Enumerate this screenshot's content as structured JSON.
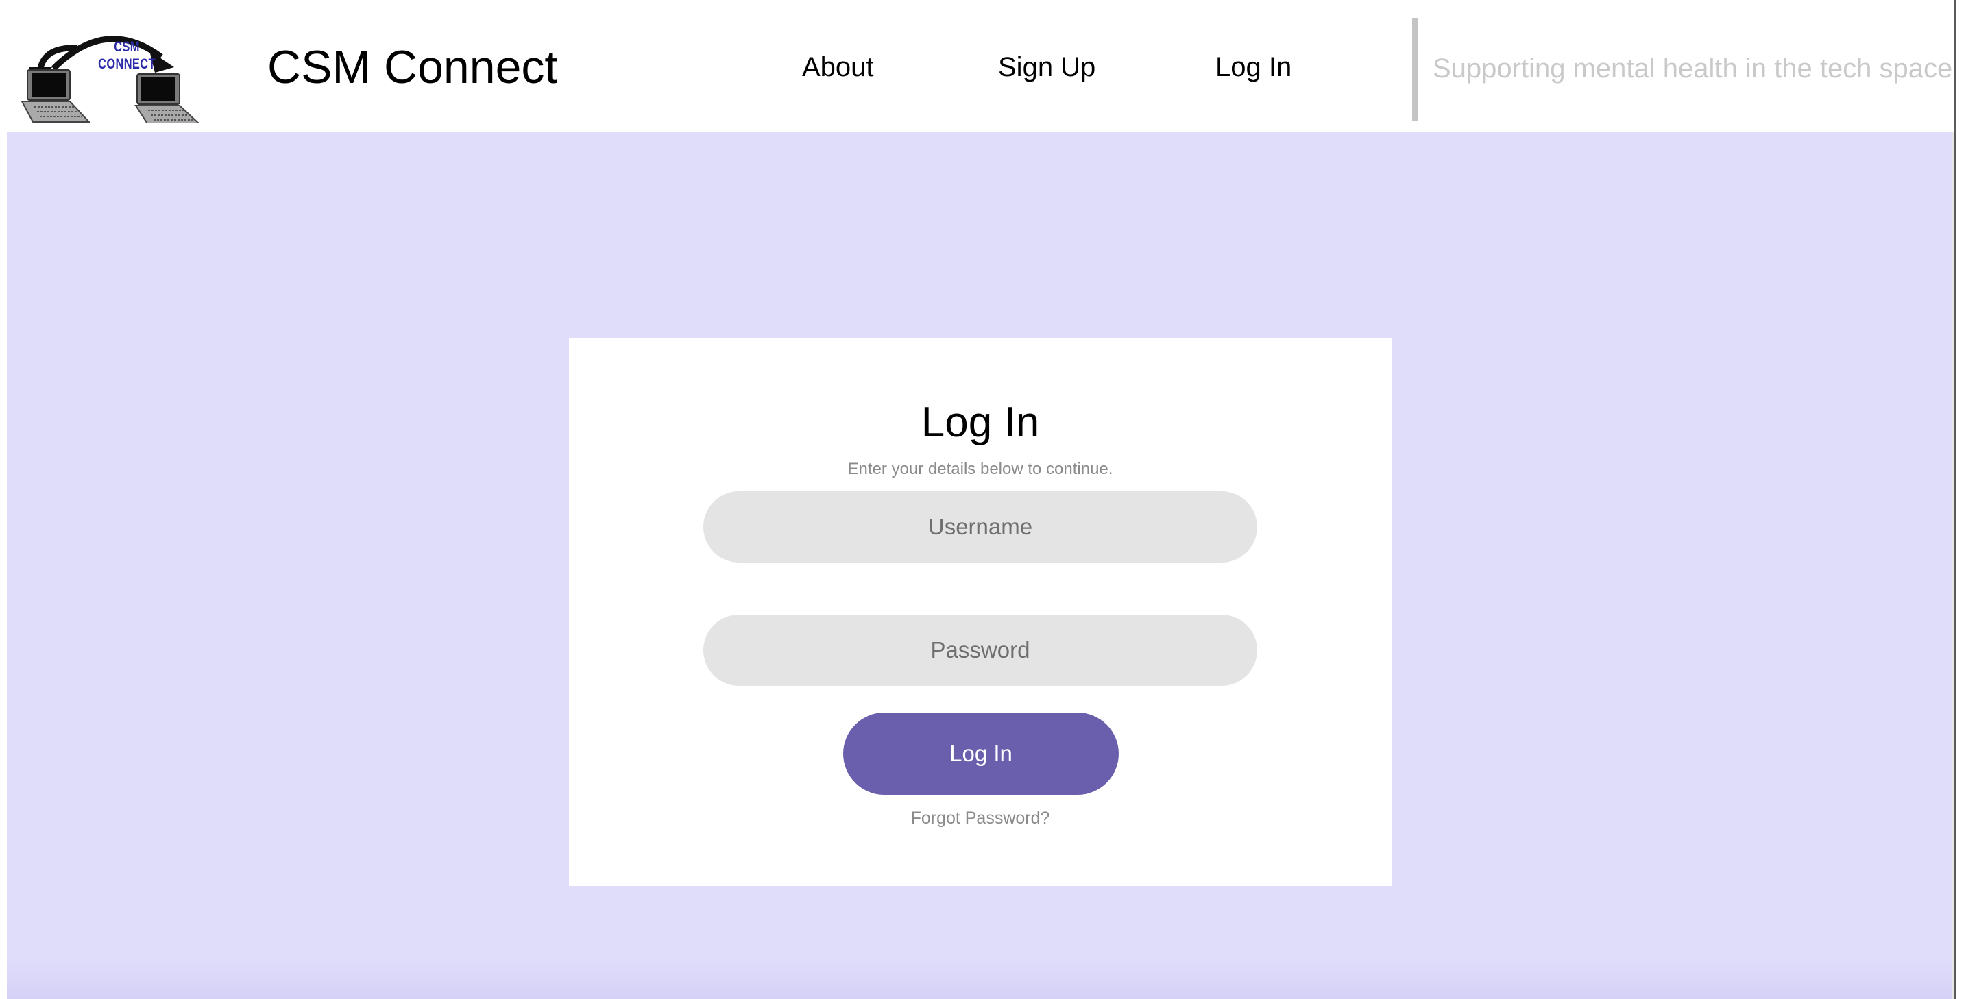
{
  "header": {
    "logo_text": "CSM\nCONNECT",
    "brand_name": "CSM Connect",
    "nav": {
      "about": "About",
      "signup": "Sign Up",
      "login": "Log In"
    },
    "tagline": "Supporting mental health in the tech space"
  },
  "login_card": {
    "title": "Log In",
    "subtitle": "Enter your details below to continue.",
    "username": {
      "value": "",
      "placeholder": "Username"
    },
    "password": {
      "value": "",
      "placeholder": "Password"
    },
    "submit_label": "Log In",
    "forgot_label": "Forgot Password?"
  },
  "colors": {
    "page_background": "#e0ddfb",
    "accent": "#6a5fac",
    "input_background": "#e4e4e4",
    "tagline": "#c9c9c9",
    "logo_text": "#2b2aa8"
  }
}
